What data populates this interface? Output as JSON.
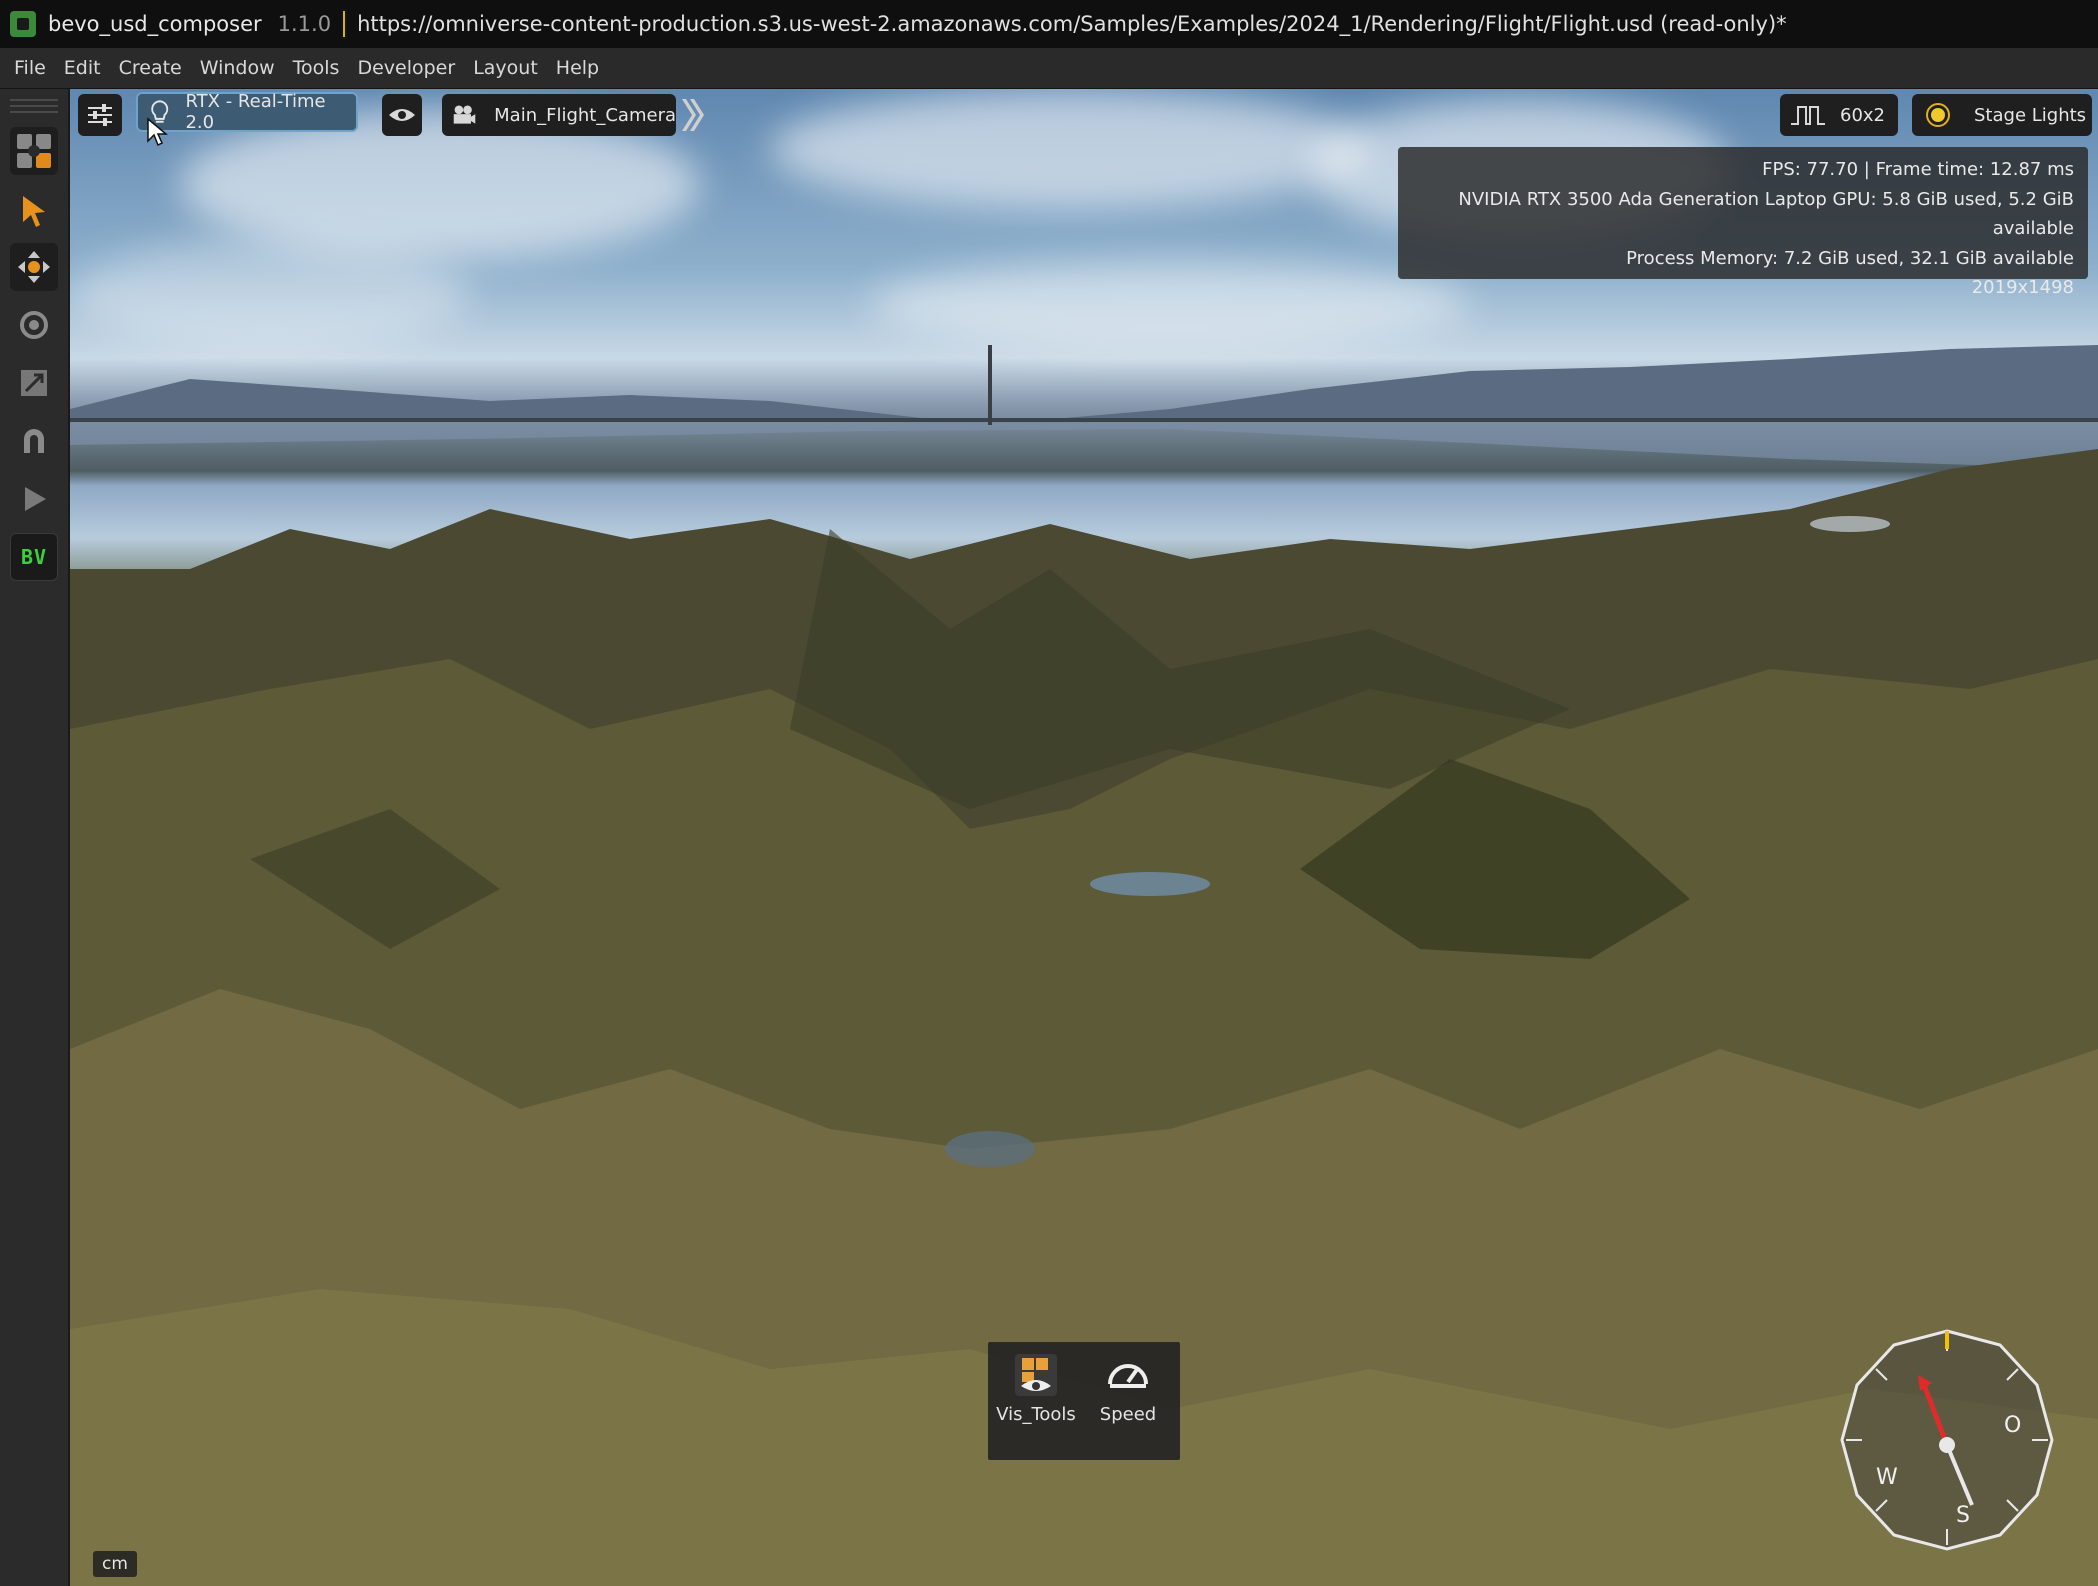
{
  "titlebar": {
    "app_name": "bevo_usd_composer",
    "version": "1.1.0",
    "path": "https://omniverse-content-production.s3.us-west-2.amazonaws.com/Samples/Examples/2024_1/Rendering/Flight/Flight.usd (read-only)*"
  },
  "menu": [
    "File",
    "Edit",
    "Create",
    "Window",
    "Tools",
    "Developer",
    "Layout",
    "Help"
  ],
  "left_toolbar": {
    "tools": [
      "select-tool",
      "move-tool",
      "rotate-tool",
      "scale-tool",
      "snap-tool",
      "play-tool",
      "bv-extension"
    ],
    "bv_label": "BV"
  },
  "viewport_toolbar": {
    "renderer_label": "RTX - Real-Time 2.0",
    "camera_label": "Main_Flight_Camera",
    "fps_label": "60x2",
    "lights_label": "Stage Lights"
  },
  "stats": {
    "fps_line": "FPS: 77.70 | Frame time: 12.87 ms",
    "gpu_line": "NVIDIA RTX 3500 Ada Generation Laptop GPU: 5.8 GiB used, 5.2 GiB available",
    "memory_line": "Process Memory: 7.2 GiB used, 32.1 GiB available",
    "resolution": "2019x1498"
  },
  "dock": {
    "items": [
      {
        "label": "Vis_Tools",
        "icon": "vis-tools-icon"
      },
      {
        "label": "Speed",
        "icon": "speedometer-icon"
      }
    ]
  },
  "compass": {
    "labels": {
      "west": "W",
      "east": "O",
      "south": "S"
    },
    "needle_color": "#e02b2b",
    "marker_color": "#f2c200"
  },
  "units_label": "cm",
  "colors": {
    "accent_active": "#6fa3c9",
    "renderer_bg": "#3d5b73",
    "title_separator": "#d9b600"
  }
}
